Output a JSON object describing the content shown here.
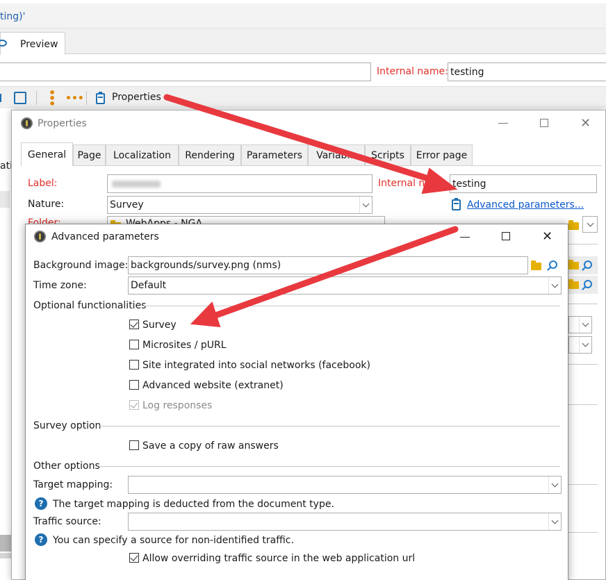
{
  "bg": {
    "title_fragment": "ting)'",
    "preview_tab": "Preview",
    "internal_name_label": "Internal name:",
    "internal_name_value": "testing",
    "properties_button": "Properties",
    "side_fragment": "ati"
  },
  "properties": {
    "title": "Properties",
    "tabs": [
      "General",
      "Page",
      "Localization",
      "Rendering",
      "Parameters",
      "Variab...",
      "Scripts",
      "Error page"
    ],
    "label_label": "Label:",
    "label_value": "",
    "internal_name_label": "Internal na",
    "internal_name_value": "testing",
    "nature_label": "Nature:",
    "nature_value": "Survey",
    "advanced_link": "Advanced parameters...",
    "folder_label": "Folder:",
    "folder_value": "WebApps - NGA"
  },
  "advanced": {
    "title": "Advanced parameters",
    "background_image_label": "Background image:",
    "background_image_value": "backgrounds/survey.png (nms)",
    "time_zone_label": "Time zone:",
    "time_zone_value": "Default",
    "optional_functionalities": "Optional functionalities",
    "options": [
      {
        "label": "Survey",
        "checked": true,
        "disabled": false
      },
      {
        "label": "Microsites / pURL",
        "checked": false,
        "disabled": false
      },
      {
        "label": "Site integrated into social networks (facebook)",
        "checked": false,
        "disabled": false
      },
      {
        "label": "Advanced website (extranet)",
        "checked": false,
        "disabled": false
      },
      {
        "label": "Log responses",
        "checked": true,
        "disabled": true
      }
    ],
    "survey_option": "Survey option",
    "save_copy": "Save a copy of raw answers",
    "other_options": "Other options",
    "target_mapping_label": "Target mapping:",
    "target_mapping_value": "",
    "target_mapping_info": "The target mapping is deducted from the document type.",
    "traffic_source_label": "Traffic source:",
    "traffic_source_value": "",
    "traffic_source_info": "You can specify a source for non-identified traffic.",
    "allow_override": "Allow overriding traffic source in the web application url"
  },
  "colors": {
    "accent_red": "#e0312b",
    "link_blue": "#0a58ca",
    "arrow_red": "#e8393f"
  }
}
